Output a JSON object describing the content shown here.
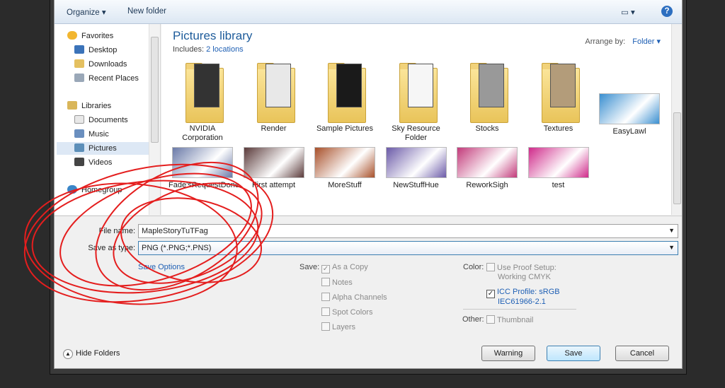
{
  "toolbar": {
    "organize": "Organize",
    "new_folder": "New folder"
  },
  "nav": {
    "favorites": "Favorites",
    "desktop": "Desktop",
    "downloads": "Downloads",
    "recent": "Recent Places",
    "libraries": "Libraries",
    "documents": "Documents",
    "music": "Music",
    "pictures": "Pictures",
    "videos": "Videos",
    "homegroup": "Homegroup"
  },
  "library": {
    "title": "Pictures library",
    "includes_label": "Includes:",
    "includes_link": "2 locations",
    "arrange_label": "Arrange by:",
    "arrange_value": "Folder"
  },
  "items": [
    {
      "name": "NVIDIA Corporation",
      "kind": "folder"
    },
    {
      "name": "Render",
      "kind": "folder"
    },
    {
      "name": "Sample Pictures",
      "kind": "folder"
    },
    {
      "name": "Sky Resource Folder",
      "kind": "folder"
    },
    {
      "name": "Stocks",
      "kind": "folder"
    },
    {
      "name": "Textures",
      "kind": "folder"
    },
    {
      "name": "EasyLawl",
      "kind": "image"
    },
    {
      "name": "Fade'sRequestDone",
      "kind": "image"
    },
    {
      "name": "First attempt",
      "kind": "image"
    },
    {
      "name": "MoreStuff",
      "kind": "image"
    },
    {
      "name": "NewStuffHue",
      "kind": "image"
    },
    {
      "name": "ReworkSigh",
      "kind": "image"
    },
    {
      "name": "test",
      "kind": "image"
    }
  ],
  "form": {
    "filename_label": "File name:",
    "filename_value": "MapleStoryTuTFag",
    "type_label": "Save as type:",
    "type_value": "PNG (*.PNG;*.PNS)",
    "save_options": "Save Options"
  },
  "save_opts": {
    "label": "Save:",
    "as_copy": "As a Copy",
    "notes": "Notes",
    "alpha": "Alpha Channels",
    "spot": "Spot Colors",
    "layers": "Layers"
  },
  "color": {
    "label": "Color:",
    "proof": "Use Proof Setup:",
    "proof2": "Working CMYK",
    "icc": "ICC Profile:  sRGB",
    "icc2": "IEC61966-2.1",
    "other_label": "Other:",
    "thumbnail": "Thumbnail"
  },
  "footer": {
    "hide": "Hide Folders",
    "warning": "Warning",
    "save": "Save",
    "cancel": "Cancel"
  },
  "colors": {
    "accent": "#1e5fb4",
    "scribble": "#e41e1e"
  }
}
